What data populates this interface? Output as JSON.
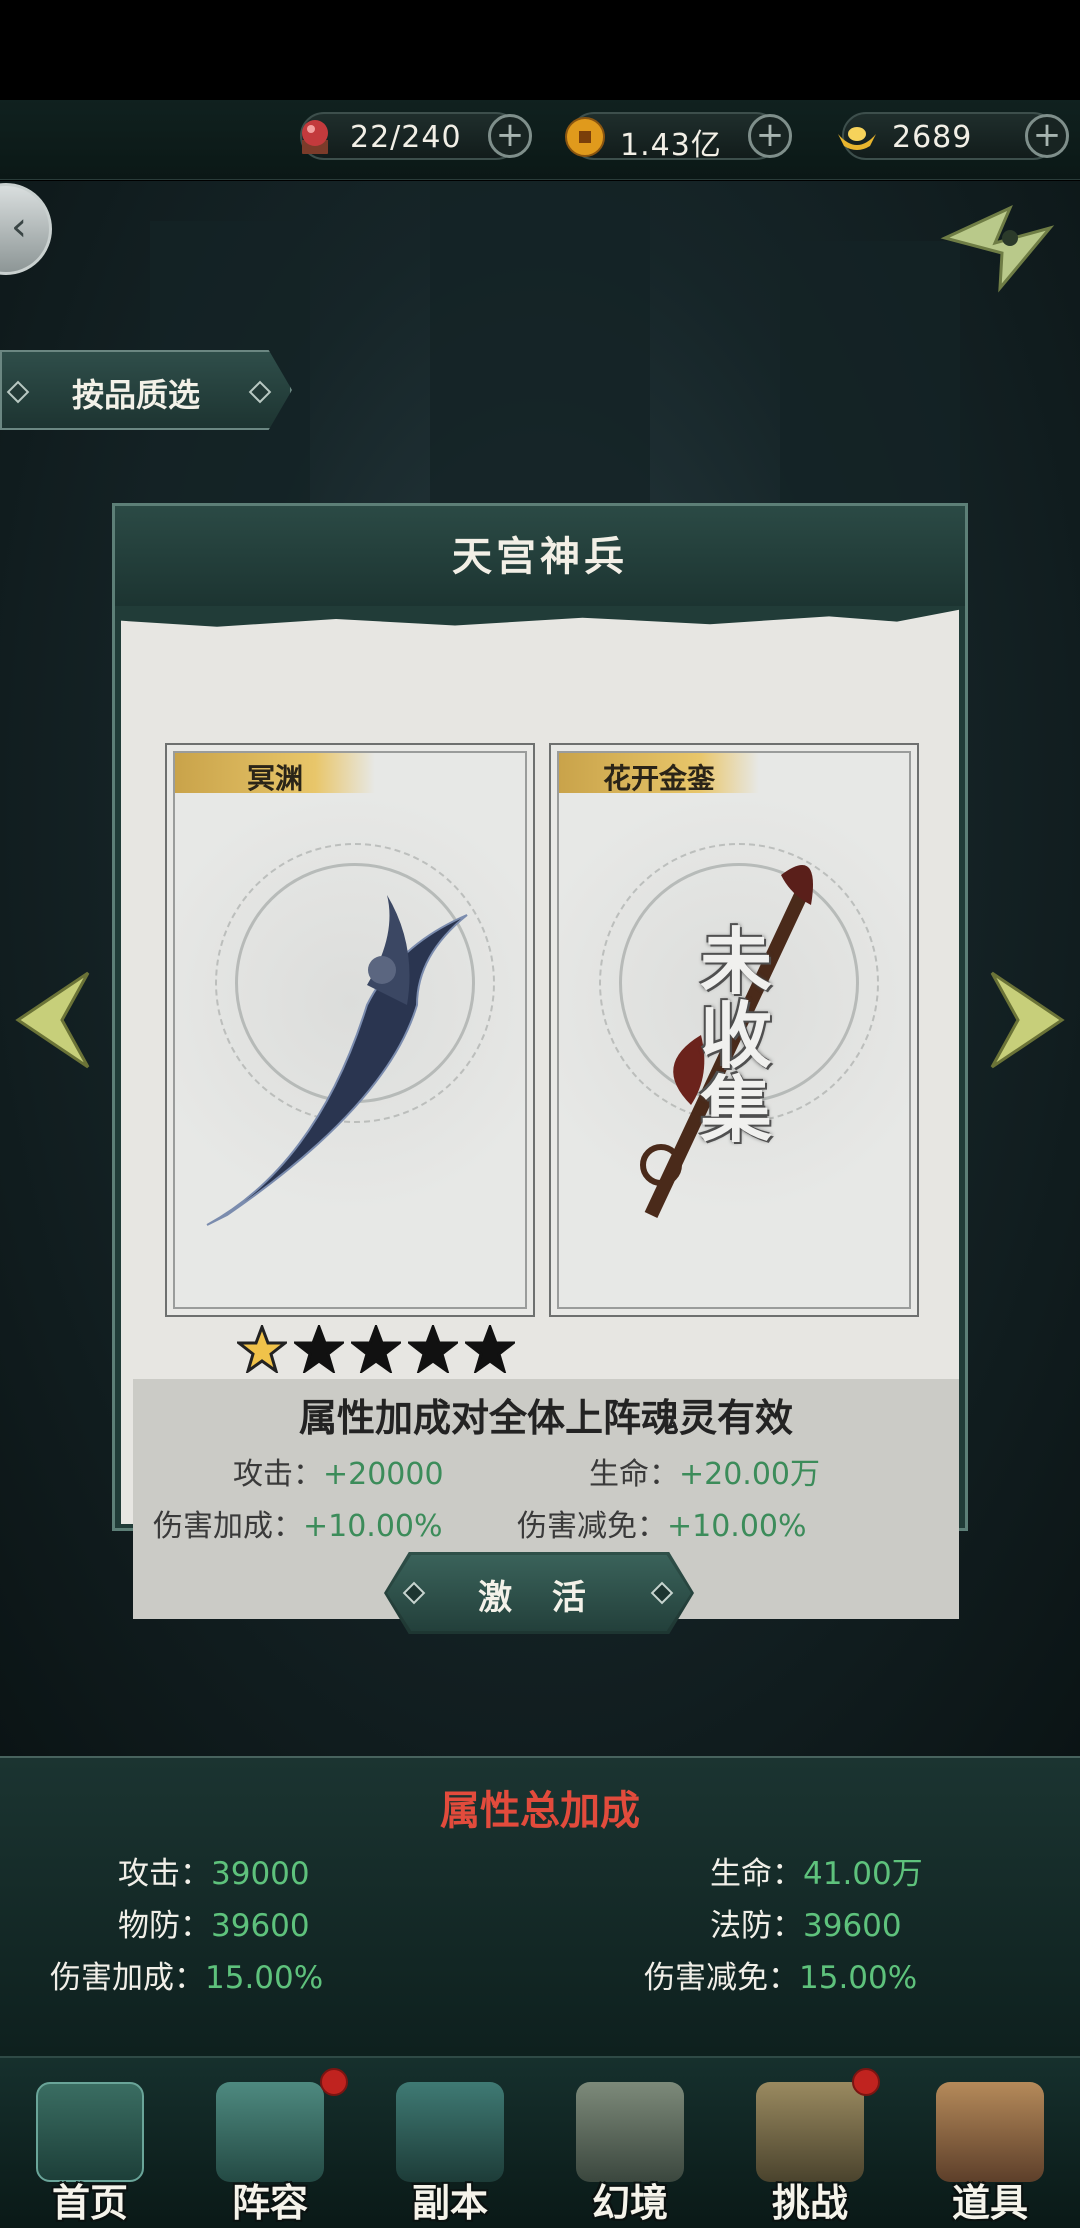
{
  "resources": [
    {
      "id": "stamina",
      "value": "22/240",
      "icon": "red-orb-icon",
      "color": "#b8373a"
    },
    {
      "id": "coins",
      "value": "1.43亿",
      "icon": "coin-icon",
      "color": "#e09a1c"
    },
    {
      "id": "ingots",
      "value": "2689",
      "icon": "gold-ingot-icon",
      "color": "#e8b52e"
    }
  ],
  "filter": {
    "label": "按品质选"
  },
  "panel": {
    "title": "天宫神兵",
    "cards": [
      {
        "name": "冥渊",
        "collected": true
      },
      {
        "name": "花开金銮",
        "collected": false,
        "status": "未收集"
      }
    ],
    "stars": {
      "filled": 1,
      "total": 5
    },
    "effect_line": "属性加成对全体上阵魂灵有效",
    "stats": [
      {
        "label": "攻击：",
        "value": "+20000"
      },
      {
        "label": "生命：",
        "value": "+20.00万"
      },
      {
        "label": "伤害加成：",
        "value": "+10.00%"
      },
      {
        "label": "伤害减免：",
        "value": "+10.00%"
      }
    ]
  },
  "activate_label": "激 活",
  "summary": {
    "title": "属性总加成",
    "stats": [
      {
        "label": "攻击：",
        "value": "39000"
      },
      {
        "label": "生命：",
        "value": "41.00万"
      },
      {
        "label": "物防：",
        "value": "39600"
      },
      {
        "label": "法防：",
        "value": "39600"
      },
      {
        "label": "伤害加成：",
        "value": "15.00%"
      },
      {
        "label": "伤害减免：",
        "value": "15.00%"
      }
    ]
  },
  "nav": [
    {
      "label": "首页",
      "icon": "home-icon",
      "badge": false
    },
    {
      "label": "阵容",
      "icon": "lineup-icon",
      "badge": true
    },
    {
      "label": "副本",
      "icon": "dungeon-icon",
      "badge": false
    },
    {
      "label": "幻境",
      "icon": "illusion-icon",
      "badge": false
    },
    {
      "label": "挑战",
      "icon": "challenge-icon",
      "badge": true
    },
    {
      "label": "道具",
      "icon": "items-icon",
      "badge": false
    }
  ]
}
